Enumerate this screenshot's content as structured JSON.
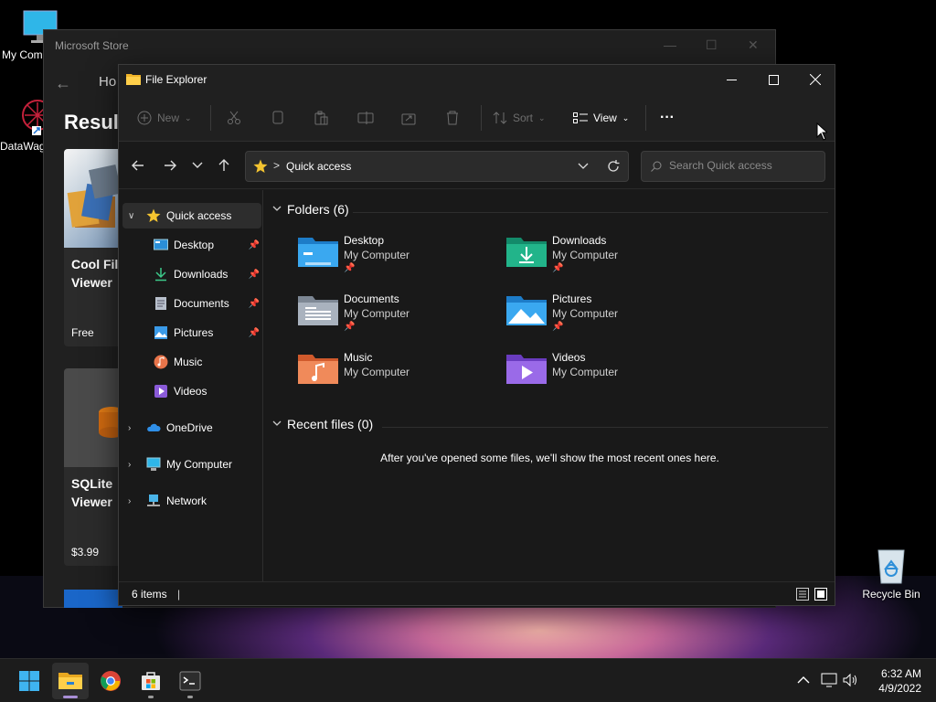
{
  "desktop": {
    "icons": [
      {
        "label": "My Comp"
      },
      {
        "label": "DataWag"
      },
      {
        "label": "Recycle Bin"
      }
    ]
  },
  "store": {
    "title": "Microsoft Store",
    "home_tab": "Ho",
    "results_heading": "Resul",
    "cards": [
      {
        "name_line1": "Cool Fil",
        "name_line2": "Viewer",
        "price": "Free"
      },
      {
        "name_line1": "SQLite",
        "name_line2": "Viewer",
        "price": "$3.99"
      }
    ]
  },
  "explorer": {
    "title": "File Explorer",
    "toolbar": {
      "new_label": "New",
      "sort_label": "Sort",
      "view_label": "View",
      "more_label": "···"
    },
    "address": {
      "path": "Quick access",
      "separator": ">"
    },
    "search": {
      "placeholder": "Search Quick access"
    },
    "sidebar": [
      {
        "label": "Quick access",
        "pinned": false
      },
      {
        "label": "Desktop",
        "pinned": true
      },
      {
        "label": "Downloads",
        "pinned": true
      },
      {
        "label": "Documents",
        "pinned": true
      },
      {
        "label": "Pictures",
        "pinned": true
      },
      {
        "label": "Music",
        "pinned": false
      },
      {
        "label": "Videos",
        "pinned": false
      },
      {
        "label": "OneDrive",
        "pinned": false
      },
      {
        "label": "My Computer",
        "pinned": false
      },
      {
        "label": "Network",
        "pinned": false
      }
    ],
    "folders_heading": "Folders (6)",
    "folders": [
      {
        "name": "Desktop",
        "location": "My Computer",
        "pinned": true
      },
      {
        "name": "Downloads",
        "location": "My Computer",
        "pinned": true
      },
      {
        "name": "Documents",
        "location": "My Computer",
        "pinned": true
      },
      {
        "name": "Pictures",
        "location": "My Computer",
        "pinned": true
      },
      {
        "name": "Music",
        "location": "My Computer",
        "pinned": false
      },
      {
        "name": "Videos",
        "location": "My Computer",
        "pinned": false
      }
    ],
    "recent_heading": "Recent files (0)",
    "recent_empty_message": "After you've opened some files, we'll show the most recent ones here.",
    "status": {
      "item_count": "6 items",
      "cursor": "|"
    }
  },
  "taskbar": {
    "clock_time": "6:32 AM",
    "clock_date": "4/9/2022"
  },
  "colors": {
    "accent_indicator": "#a98fd6",
    "folder_blue": "#3aa0e8",
    "star_yellow": "#f4c430"
  }
}
